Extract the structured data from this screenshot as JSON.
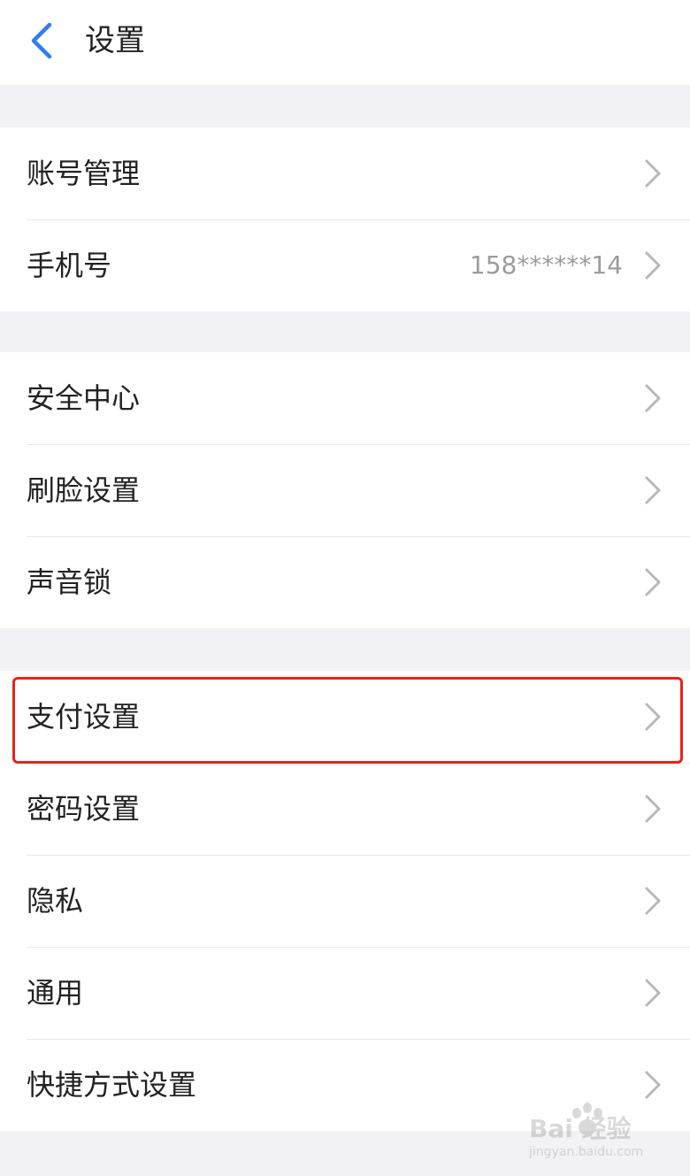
{
  "header": {
    "back_icon": "chevron-left-icon",
    "title": "设置"
  },
  "accent_color": "#2f7cf6",
  "highlight_color": "#e8221f",
  "groups": [
    {
      "items": [
        {
          "label": "账号管理",
          "value": ""
        },
        {
          "label": "手机号",
          "value": "158******14"
        }
      ]
    },
    {
      "items": [
        {
          "label": "安全中心",
          "value": ""
        },
        {
          "label": "刷脸设置",
          "value": ""
        },
        {
          "label": "声音锁",
          "value": ""
        }
      ]
    },
    {
      "items": [
        {
          "label": "支付设置",
          "value": ""
        },
        {
          "label": "密码设置",
          "value": ""
        },
        {
          "label": "隐私",
          "value": ""
        },
        {
          "label": "通用",
          "value": ""
        },
        {
          "label": "快捷方式设置",
          "value": ""
        }
      ]
    }
  ],
  "watermark": {
    "main": "Bai 经验",
    "sub": "jingyan.baidu.com"
  }
}
